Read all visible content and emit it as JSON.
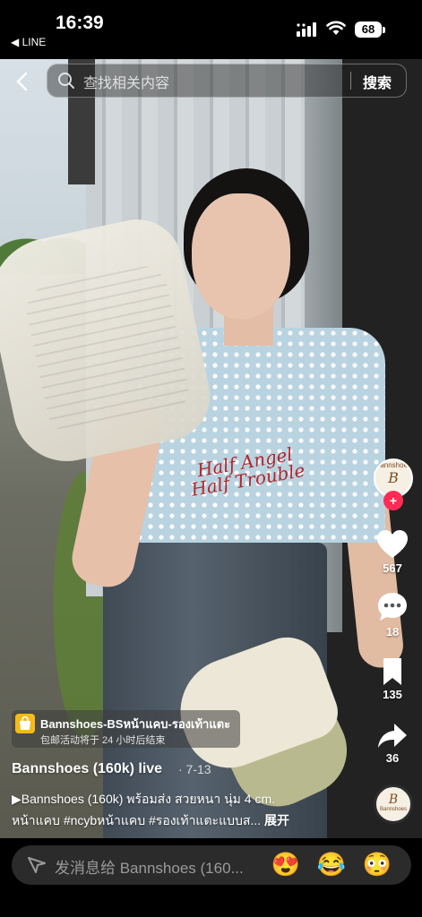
{
  "status_bar": {
    "time": "16:39",
    "back_app": "◀ LINE",
    "battery": "68"
  },
  "header": {
    "search_placeholder": "查找相关内容",
    "search_button": "搜索"
  },
  "video_overlay": {
    "shirt_print": "Half Angel Half Trouble"
  },
  "rail": {
    "avatar_label": "Bannshoes",
    "like_count": "567",
    "comment_count": "18",
    "save_count": "135",
    "share_count": "36",
    "disc_label": "Bannshoes"
  },
  "anchor": {
    "title": "Bannshoes-BSหน้าแคบ-รองเท้าแตะ",
    "subtitle": "包邮活动将于 24 小时后结束"
  },
  "caption": {
    "author": "Bannshoes (160k) live",
    "date": "· 7-13",
    "line1": "▶Bannshoes (160k)  พร้อมส่ง สวยหนา นุ่ม 4 cm.",
    "line2": "หน้าแคบ #ncybหน้าแคบ #รองเท้าแตะแบบส...",
    "expand": "展开"
  },
  "comment_bar": {
    "placeholder": "发消息给 Bannshoes (160...",
    "emojis": [
      "😍",
      "😂",
      "😳"
    ]
  },
  "colors": {
    "follow_badge": "#fe2c55",
    "shop_icon": "#f5b91a"
  }
}
